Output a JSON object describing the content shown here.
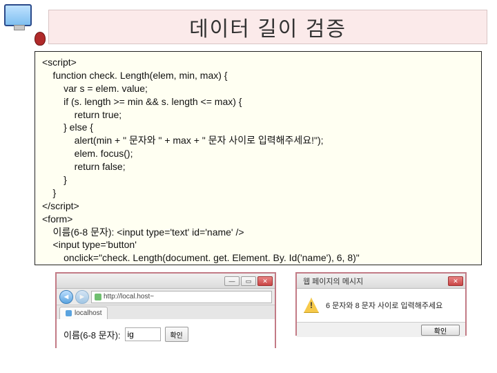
{
  "title": "데이터 길이 검증",
  "code": "<script>\n    function check. Length(elem, min, max) {\n        var s = elem. value;\n        if (s. length >= min && s. length <= max) {\n            return true;\n        } else {\n            alert(min + \" 문자와 \" + max + \" 문자 사이로 입력해주세요!\");\n            elem. focus();\n            return false;\n        }\n    }\n</script>\n<form>\n    이름(6-8 문자): <input type='text' id='name' />\n    <input type='button'\n        onclick=\"check. Length(document. get. Element. By. Id('name'), 6, 8)\"\n        value='확인' />\n</form>",
  "browser1": {
    "address": "http://local.host~",
    "tab_label": "localhost",
    "form_label": "이름(6-8 문자):",
    "input_value": "ig",
    "button_label": "확인"
  },
  "browser2": {
    "title": "웹 페이지의 메시지",
    "message": "6 문자와 8 문자 사이로 입력해주세요",
    "ok": "확인"
  }
}
